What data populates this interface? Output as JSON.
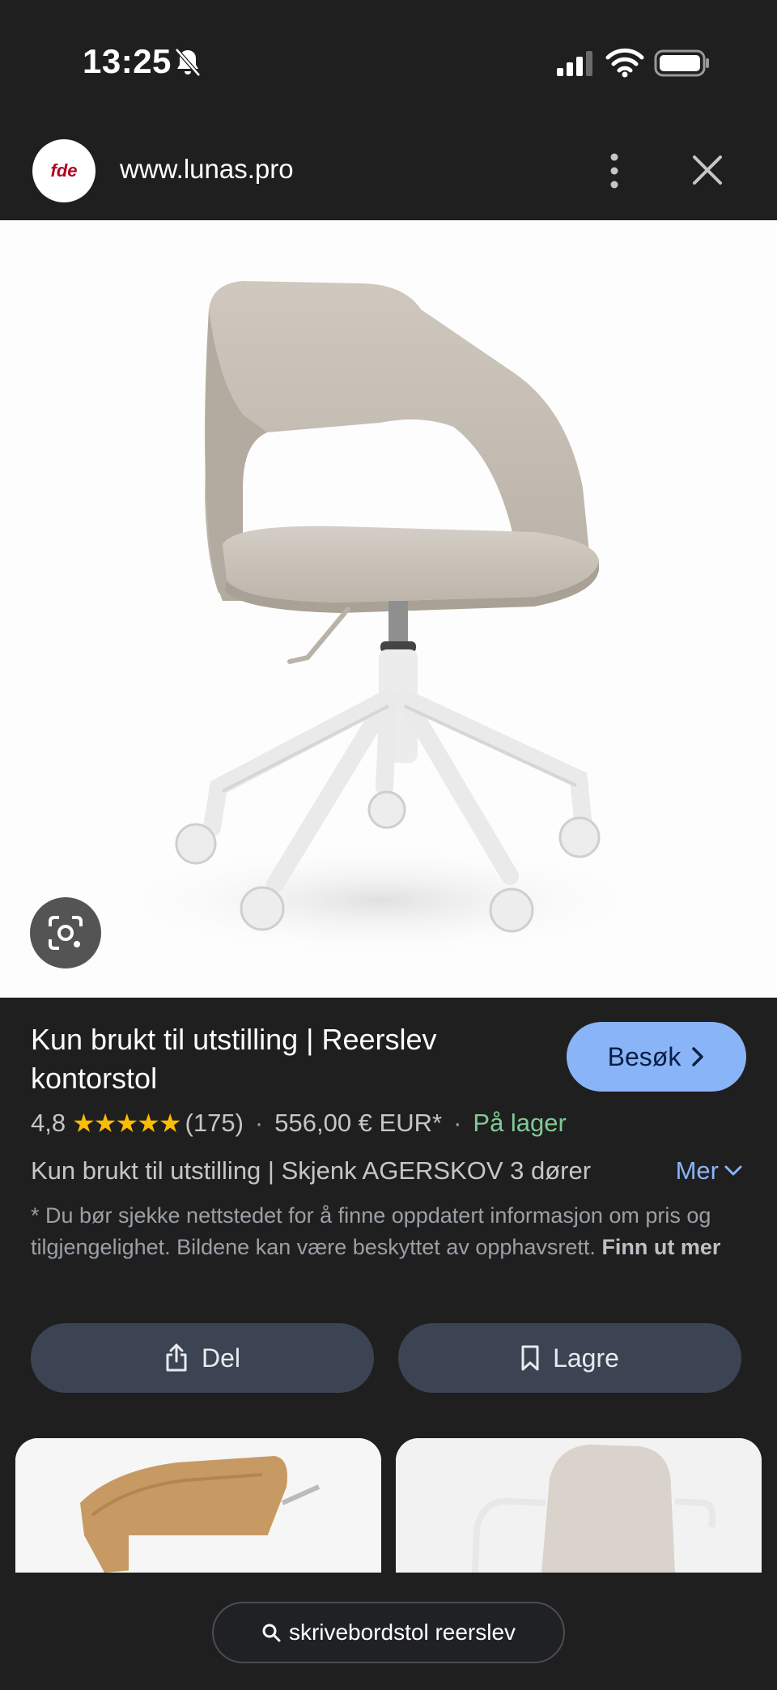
{
  "status_bar": {
    "time": "13:25",
    "icons": [
      "bell-slash-icon",
      "signal-icon",
      "wifi-icon",
      "battery-icon"
    ]
  },
  "browser": {
    "logo_text": "fde",
    "url": "www.lunas.pro",
    "icons": [
      "kebab-menu-icon",
      "close-icon"
    ]
  },
  "product": {
    "title": "Kun brukt til utstilling | Reerslev kontorstol",
    "visit_label": "Besøk",
    "rating": "4,8",
    "stars": "★★★★★",
    "review_count": "(175)",
    "price": "556,00 € EUR*",
    "stock": "På lager",
    "description": "Kun brukt til utstilling | Skjenk AGERSKOV 3 dører",
    "more_label": "Mer",
    "disclaimer": "* Du bør sjekke nettstedet for å finne oppdatert informasjon om pris og tilgjengelighet. Bildene kan være beskyttet av opphavsrett.",
    "learn_more": "Finn ut mer"
  },
  "actions": {
    "share_label": "Del",
    "save_label": "Lagre"
  },
  "colors": {
    "background": "#1f1f1f",
    "accent": "#8ab4f8",
    "stock_green": "#81c995",
    "star": "#fbbc04",
    "action_button": "#3c4453"
  },
  "search": {
    "query": "skrivebordstol reerslev"
  }
}
